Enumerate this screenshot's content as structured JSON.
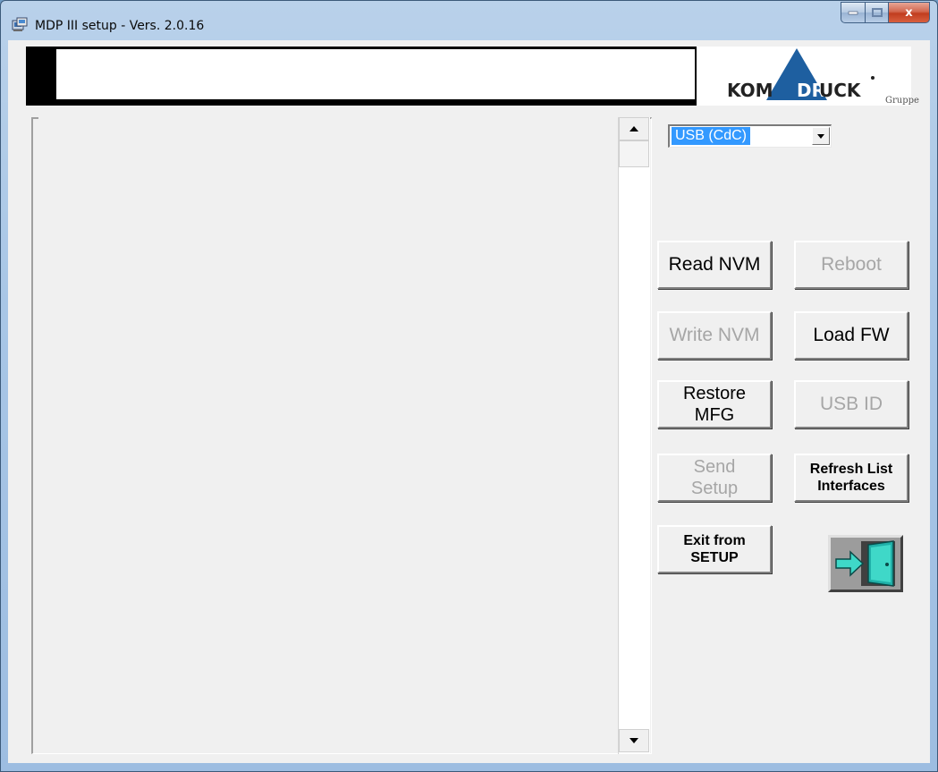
{
  "window": {
    "title": "MDP III setup - Vers. 2.0.16",
    "caption_buttons": {
      "minimize": "minimize-icon",
      "maximize": "maximize-icon",
      "close": "x"
    }
  },
  "logo": {
    "part1": "KOM",
    "part2": "DR",
    "part3": "UCK",
    "suffix": "Gruppe",
    "brand_color": "#1e5fa0"
  },
  "interface_select": {
    "value": "USB (CdC)"
  },
  "buttons": {
    "read_nvm": "Read NVM",
    "reboot": "Reboot",
    "write_nvm": "Write NVM",
    "load_fw": "Load FW",
    "restore_mfg_line1": "Restore",
    "restore_mfg_line2": "MFG",
    "usb_id": "USB ID",
    "send_setup_line1": "Send",
    "send_setup_line2": "Setup",
    "refresh_list_line1": "Refresh List",
    "refresh_list_line2": "Interfaces",
    "exit_line1": "Exit from",
    "exit_line2": "SETUP"
  },
  "icons": {
    "exit": "exit-door-icon",
    "scroll_up": "scroll-up-arrow",
    "scroll_down": "scroll-down-arrow"
  }
}
